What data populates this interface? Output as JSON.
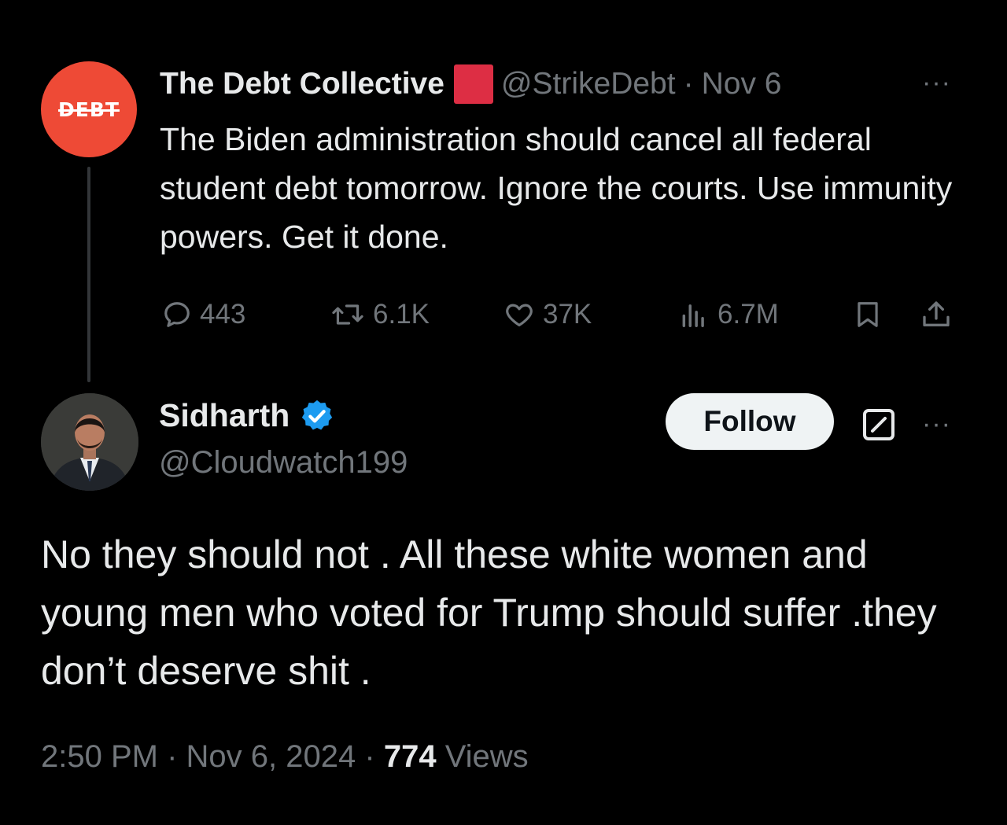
{
  "parent_tweet": {
    "avatar_text": "DEBT",
    "author_name": "The Debt Collective",
    "handle": "@StrikeDebt",
    "separator": "·",
    "date": "Nov 6",
    "more_icon": "···",
    "text": "The Biden administration should cancel all federal student debt tomorrow. Ignore the courts. Use immunity powers. Get it done.",
    "stats": {
      "replies": "443",
      "reposts": "6.1K",
      "likes": "37K",
      "views": "6.7M"
    },
    "icons": [
      "reply-icon",
      "repost-icon",
      "like-icon",
      "views-icon",
      "bookmark-icon",
      "share-icon"
    ]
  },
  "reply_tweet": {
    "author_name": "Sidharth",
    "handle": "@Cloudwatch199",
    "follow_label": "Follow",
    "more_icon": "···",
    "text": "No they should not . All these white women and young men who voted for Trump should suffer .they don’t deserve shit .",
    "time": "2:50 PM",
    "separator": "·",
    "date": "Nov 6, 2024",
    "views_count": "774",
    "views_label": "Views"
  },
  "colors": {
    "background": "#000000",
    "text_primary": "#e7e9ea",
    "text_secondary": "#71767b",
    "debt_avatar": "#ee4a36",
    "red_square": "#dd2e44",
    "verified": "#1d9bf0"
  }
}
